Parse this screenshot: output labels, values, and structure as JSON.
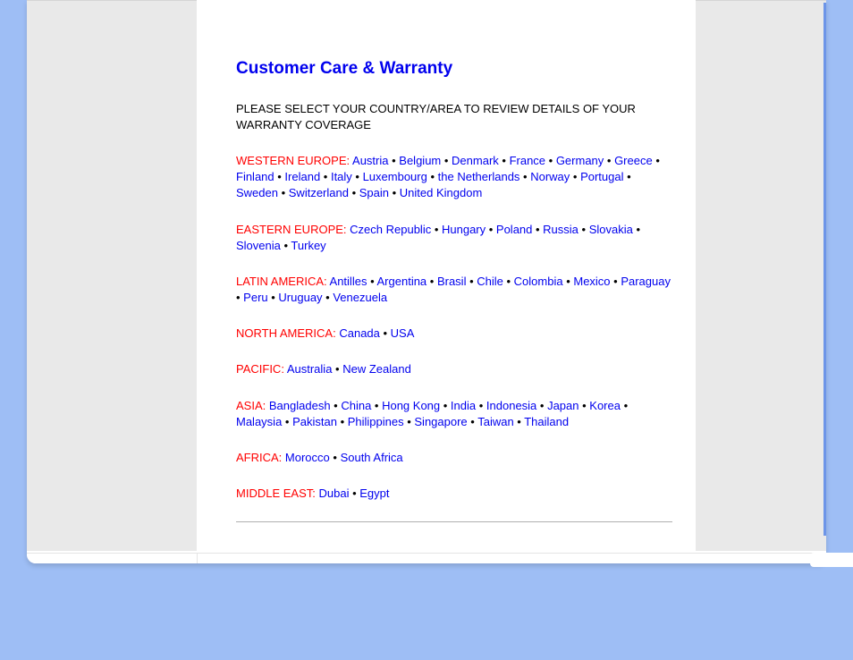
{
  "title": "Customer Care & Warranty",
  "intro": "PLEASE SELECT YOUR COUNTRY/AREA TO REVIEW DETAILS OF YOUR WARRANTY COVERAGE",
  "regions": [
    {
      "label": "WESTERN EUROPE:",
      "countries": [
        "Austria",
        "Belgium",
        "Denmark",
        "France",
        "Germany",
        "Greece",
        "Finland",
        "Ireland",
        "Italy",
        "Luxembourg",
        "the Netherlands",
        "Norway",
        "Portugal",
        "Sweden",
        "Switzerland",
        "Spain",
        "United Kingdom"
      ]
    },
    {
      "label": "EASTERN EUROPE:",
      "countries": [
        "Czech Republic",
        "Hungary",
        "Poland",
        "Russia",
        "Slovakia",
        "Slovenia",
        "Turkey"
      ]
    },
    {
      "label": "LATIN AMERICA:",
      "countries": [
        "Antilles",
        "Argentina",
        "Brasil",
        "Chile",
        "Colombia",
        "Mexico",
        "Paraguay",
        "Peru",
        "Uruguay",
        "Venezuela"
      ]
    },
    {
      "label": "NORTH AMERICA:",
      "countries": [
        "Canada",
        "USA"
      ]
    },
    {
      "label": "PACIFIC:",
      "countries": [
        "Australia",
        "New Zealand"
      ]
    },
    {
      "label": "ASIA:",
      "countries": [
        "Bangladesh",
        "China",
        "Hong Kong",
        "India",
        "Indonesia",
        "Japan",
        "Korea",
        "Malaysia",
        "Pakistan",
        "Philippines",
        "Singapore",
        "Taiwan",
        "Thailand"
      ]
    },
    {
      "label": "AFRICA:",
      "countries": [
        "Morocco",
        "South Africa"
      ]
    },
    {
      "label": "MIDDLE EAST:",
      "countries": [
        "Dubai",
        "Egypt"
      ]
    }
  ],
  "separator": " • "
}
